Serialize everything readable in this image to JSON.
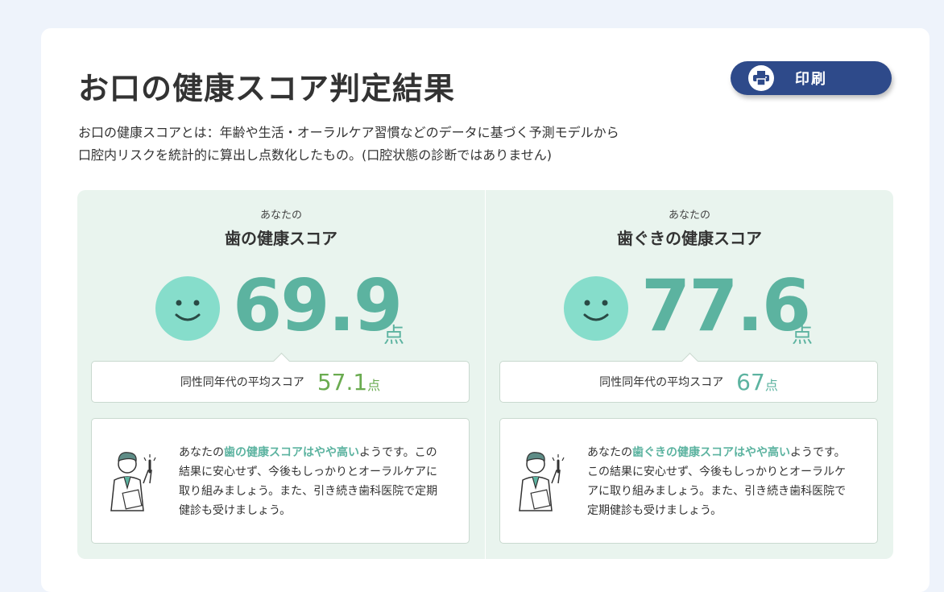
{
  "page": {
    "title": "お口の健康スコア判定結果",
    "print_label": "印刷",
    "description_lines": [
      "お口の健康スコアとは：年齢や生活・オーラルケア習慣などのデータに基づく予測モデルから",
      "口腔内リスクを統計的に算出し点数化したもの。(口腔状態の診断ではありません)"
    ]
  },
  "scores": [
    {
      "subtitle": "あなたの",
      "title": "歯の健康スコア",
      "score": "69.9",
      "score_unit": "点",
      "face_icon": "smiley-face-icon",
      "avg_label": "同性同年代の平均スコア",
      "avg_value": "57.1",
      "avg_unit": "点",
      "avg_color": "#6aab50",
      "advice_prefix": "あなたの",
      "advice_highlight": "歯の健康スコアはやや高い",
      "advice_rest": "ようです。この結果に安心せず、今後もしっかりとオーラルケアに取り組みましょう。また、引き続き歯科医院で定期健診も受けましょう。"
    },
    {
      "subtitle": "あなたの",
      "title": "歯ぐきの健康スコア",
      "score": "77.6",
      "score_unit": "点",
      "face_icon": "smiley-face-icon",
      "avg_label": "同性同年代の平均スコア",
      "avg_value": "67",
      "avg_unit": "点",
      "avg_color": "#5cb3a0",
      "advice_prefix": "あなたの",
      "advice_highlight": "歯ぐきの健康スコアはやや高い",
      "advice_rest": "ようです。この結果に安心せず、今後もしっかりとオーラルケアに取り組みましょう。また、引き続き歯科医院で定期健診も受けましょう。"
    }
  ],
  "colors": {
    "accent": "#5cb3a0",
    "face": "#86ddcb",
    "button": "#2e4a8a",
    "panel": "#e9f4ee"
  }
}
